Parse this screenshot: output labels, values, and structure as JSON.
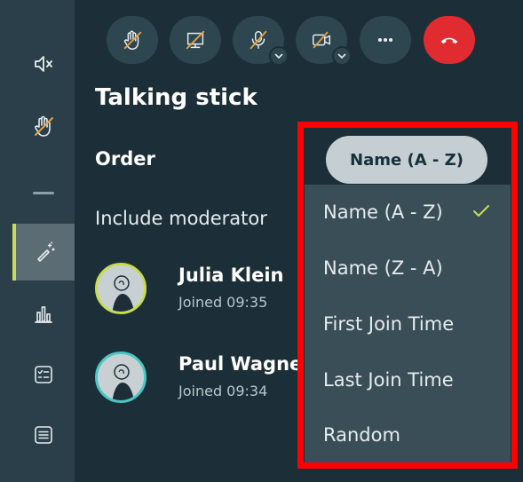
{
  "rail": {
    "items": [
      {
        "icon": "speaker-muted-icon"
      },
      {
        "icon": "hand-off-icon"
      },
      {
        "icon": "magic-wand-icon",
        "active": true
      },
      {
        "icon": "bar-chart-icon"
      },
      {
        "icon": "checklist-icon"
      },
      {
        "icon": "list-icon"
      }
    ]
  },
  "toolbar": {
    "buttons": [
      {
        "icon": "hand-off-icon"
      },
      {
        "icon": "screen-share-off-icon"
      },
      {
        "icon": "mic-off-icon",
        "has_menu": true
      },
      {
        "icon": "camera-off-icon",
        "has_menu": true
      },
      {
        "icon": "more-icon"
      },
      {
        "icon": "hang-up-icon",
        "color": "#e02b31"
      }
    ]
  },
  "panel": {
    "title": "Talking stick",
    "order_label": "Order",
    "order_value": "Name (A - Z)",
    "include_label": "Include moderator"
  },
  "participants": [
    {
      "name": "Julia Klein",
      "joined": "Joined 09:35",
      "ring_color": "#c8dc50"
    },
    {
      "name": "Paul Wagne",
      "joined": "Joined 09:34",
      "ring_color": "#48c8c0"
    }
  ],
  "menu": {
    "items": [
      {
        "label": "Name (A - Z)",
        "selected": true
      },
      {
        "label": "Name (Z - A)"
      },
      {
        "label": "First Join Time"
      },
      {
        "label": "Last Join Time"
      },
      {
        "label": "Random"
      }
    ]
  },
  "colors": {
    "accent": "#c8dc50",
    "highlight": "#ff0000"
  }
}
